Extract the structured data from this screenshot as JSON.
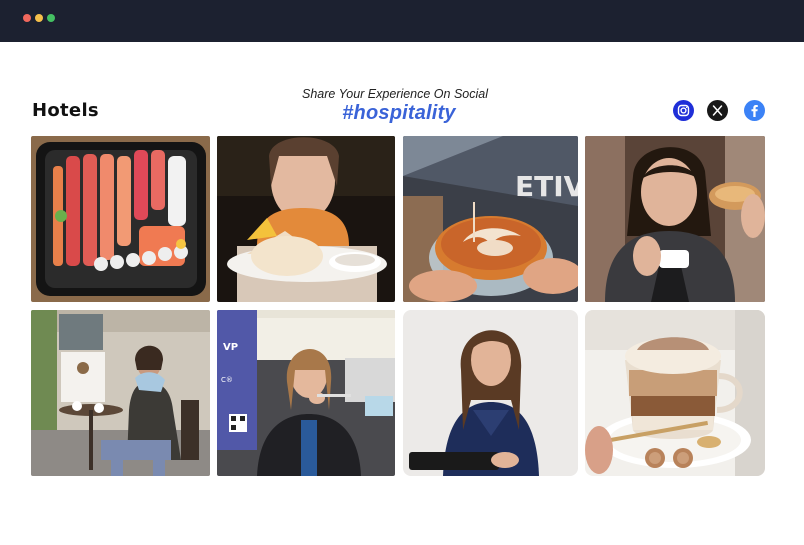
{
  "window": {
    "controls": [
      "close",
      "minimize",
      "maximize"
    ]
  },
  "header": {
    "title": "Hotels",
    "tagline": "Share Your Experience On Social",
    "hashtag": "#hospitality"
  },
  "social_links": [
    {
      "name": "instagram-icon",
      "color": "#1f2fd8"
    },
    {
      "name": "x-icon",
      "color": "#181818"
    },
    {
      "name": "facebook-icon",
      "color": "#3b82f6"
    }
  ],
  "gallery": {
    "rows": 2,
    "columns": 4,
    "tiles": [
      {
        "subject": "sushi-platter"
      },
      {
        "subject": "woman-with-dessert"
      },
      {
        "subject": "latte-art"
      },
      {
        "subject": "woman-eating-pastry"
      },
      {
        "subject": "woman-at-cafe"
      },
      {
        "subject": "woman-at-event"
      },
      {
        "subject": "hotel-staff-with-tablet"
      },
      {
        "subject": "cappuccino-and-truffles"
      }
    ]
  },
  "colors": {
    "titlebar": "#1c2130",
    "hashtag": "#3a63d8",
    "background": "#ffffff"
  }
}
